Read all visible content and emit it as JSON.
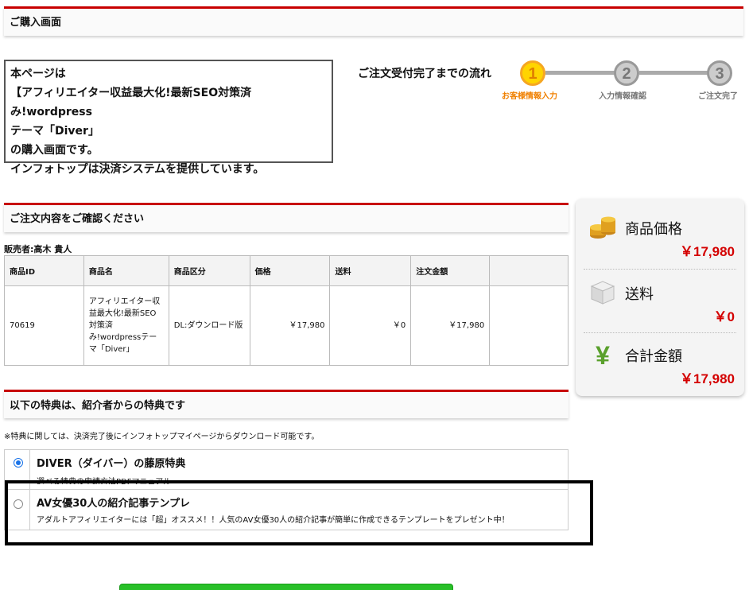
{
  "header": {
    "purchase_title": "ご購入画面"
  },
  "info": {
    "line1": "本ページは",
    "line2": "【アフィリエイター収益最大化!最新SEO対策済み!wordpress",
    "line3": "テーマ「Diver」",
    "line4": "の購入画面です。",
    "line5": "インフォトップは決済システムを提供しています。"
  },
  "flow": {
    "title": "ご注文受付完了までの流れ",
    "steps": [
      {
        "num": "1",
        "label": "お客様情報入力"
      },
      {
        "num": "2",
        "label": "入力情報確認"
      },
      {
        "num": "3",
        "label": "ご注文完了"
      }
    ]
  },
  "confirm": {
    "title": "ご注文内容をご確認ください",
    "seller": "販売者:高木 貴人"
  },
  "table": {
    "headers": [
      "商品ID",
      "商品名",
      "商品区分",
      "価格",
      "送料",
      "注文金額",
      ""
    ],
    "row": {
      "id": "70619",
      "name": "アフィリエイター収益最大化!最新SEO対策済み!wordpressテーマ「Diver」",
      "category": "DL:ダウンロード版",
      "price": "￥17,980",
      "shipping": "￥0",
      "total": "￥17,980"
    }
  },
  "summary": {
    "product_price_label": "商品価格",
    "product_price": "￥17,980",
    "shipping_label": "送料",
    "shipping": "￥0",
    "total_label": "合計金額",
    "total": "￥17,980",
    "colors": {
      "price": "#d40000",
      "coin": "#e0a020",
      "yen_icon": "#5aa02c"
    }
  },
  "bonus": {
    "title": "以下の特典は、紹介者からの特典です",
    "note": "※特典に関しては、決済完了後にインフォトップマイページからダウンロード可能です。",
    "items": [
      {
        "title": "DIVER（ダイバー）の藤原特典",
        "desc": "選べる特典の申請方法PDFマニュアル",
        "selected": true
      },
      {
        "title": "AV女優30人の紹介記事テンプレ",
        "desc": "アダルトアフィリエイターには「超」オススメ！！人気のAV女優30人の紹介記事が簡単に作成できるテンプレートをプレゼント中！",
        "selected": false
      }
    ]
  },
  "accent": {
    "red": "#c80000",
    "orange": "#f08000",
    "green": "#28c028"
  }
}
